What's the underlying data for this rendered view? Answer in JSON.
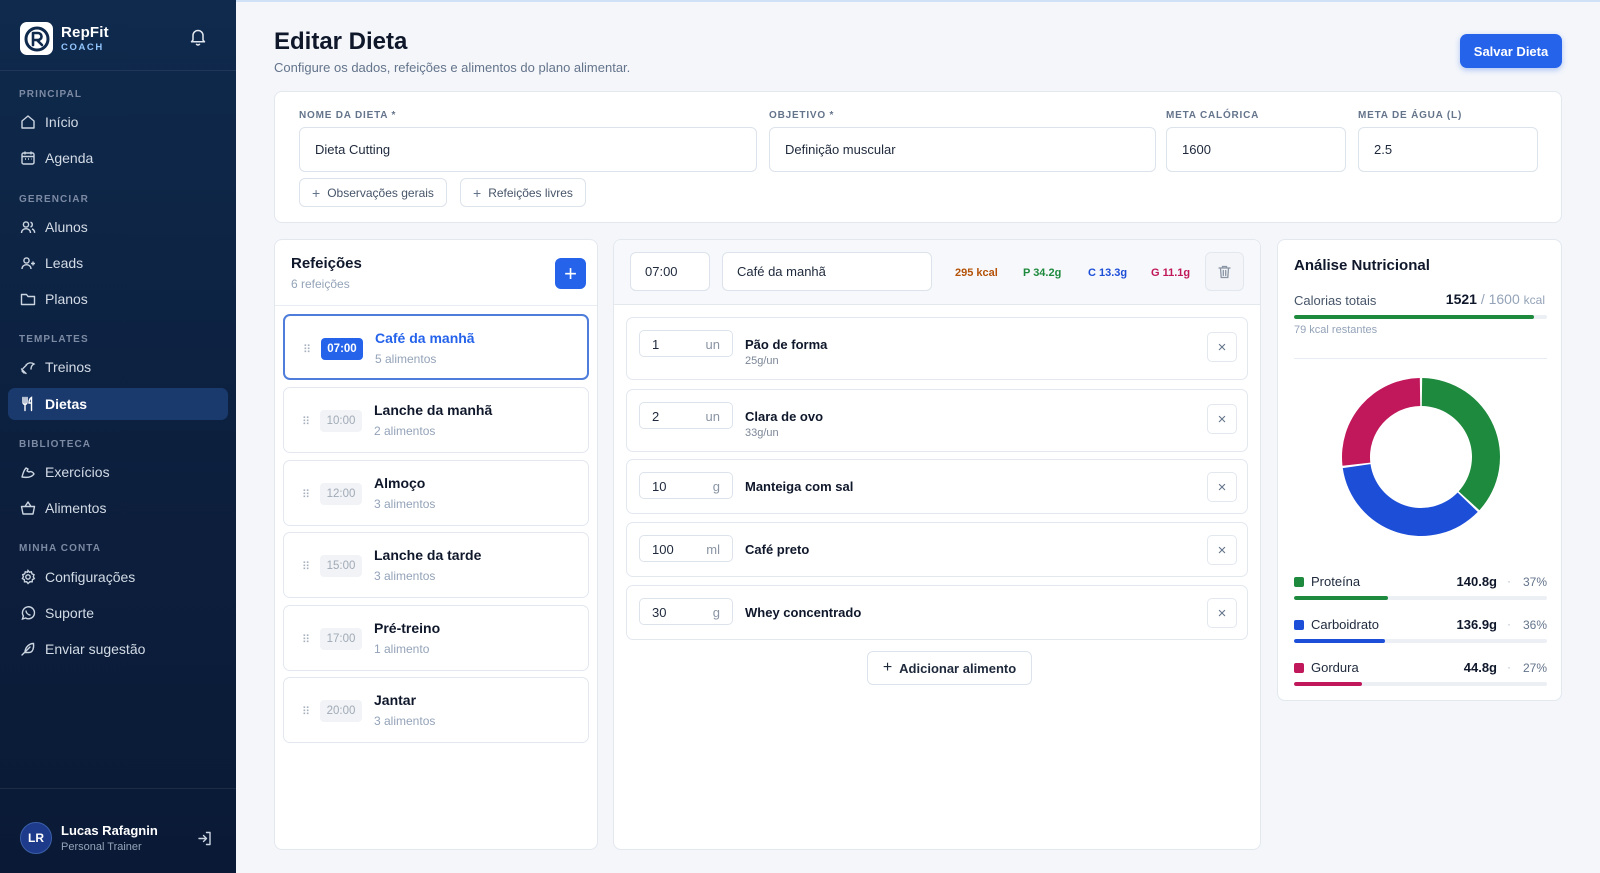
{
  "brand": {
    "name": "RepFit",
    "sub": "COACH"
  },
  "sidebar": {
    "sections": [
      "PRINCIPAL",
      "GERENCIAR",
      "TEMPLATES",
      "BIBLIOTECA",
      "MINHA CONTA"
    ],
    "items": [
      {
        "label": "Início",
        "icon": "home-icon"
      },
      {
        "label": "Agenda",
        "icon": "calendar-icon"
      },
      {
        "label": "Alunos",
        "icon": "users-icon"
      },
      {
        "label": "Leads",
        "icon": "user-plus-icon"
      },
      {
        "label": "Planos",
        "icon": "folder-icon"
      },
      {
        "label": "Treinos",
        "icon": "dumbbell-icon"
      },
      {
        "label": "Dietas",
        "icon": "utensils-icon"
      },
      {
        "label": "Exercícios",
        "icon": "biceps-icon"
      },
      {
        "label": "Alimentos",
        "icon": "basket-icon"
      },
      {
        "label": "Configurações",
        "icon": "gear-icon"
      },
      {
        "label": "Suporte",
        "icon": "whatsapp-icon"
      },
      {
        "label": "Enviar sugestão",
        "icon": "feather-icon"
      }
    ],
    "active_item": "Dietas"
  },
  "user": {
    "initials": "LR",
    "name": "Lucas Rafagnin",
    "role": "Personal Trainer"
  },
  "header": {
    "title": "Editar Dieta",
    "subtitle": "Configure os dados, refeições e alimentos do plano alimentar.",
    "save_label": "Salvar Dieta"
  },
  "form": {
    "name_label": "NOME DA DIETA *",
    "name_value": "Dieta Cutting",
    "goal_label": "OBJETIVO *",
    "goal_value": "Definição muscular",
    "calorie_label": "META CALÓRICA",
    "calorie_value": "1600",
    "water_label": "META DE ÁGUA (L)",
    "water_value": "2.5",
    "notes_button": "Observações gerais",
    "free_meals_button": "Refeições livres"
  },
  "meals": {
    "title": "Refeições",
    "count": "6 refeições",
    "items": [
      {
        "time": "07:00",
        "name": "Café da manhã",
        "count": "5 alimentos"
      },
      {
        "time": "10:00",
        "name": "Lanche da manhã",
        "count": "2 alimentos"
      },
      {
        "time": "12:00",
        "name": "Almoço",
        "count": "3 alimentos"
      },
      {
        "time": "15:00",
        "name": "Lanche da tarde",
        "count": "3 alimentos"
      },
      {
        "time": "17:00",
        "name": "Pré-treino",
        "count": "1 alimento"
      },
      {
        "time": "20:00",
        "name": "Jantar",
        "count": "3 alimentos"
      }
    ]
  },
  "editor": {
    "time": "07:00",
    "meal_name": "Café da manhã",
    "kcal": "295 kcal",
    "protein": "P 34.2g",
    "carbs": "C 13.3g",
    "fat": "G 11.1g",
    "foods": [
      {
        "qty": "1",
        "unit": "un",
        "name": "Pão de forma",
        "detail": "25g/un"
      },
      {
        "qty": "2",
        "unit": "un",
        "name": "Clara de ovo",
        "detail": "33g/un"
      },
      {
        "qty": "10",
        "unit": "g",
        "name": "Manteiga com sal",
        "detail": ""
      },
      {
        "qty": "100",
        "unit": "ml",
        "name": "Café preto",
        "detail": ""
      },
      {
        "qty": "30",
        "unit": "g",
        "name": "Whey concentrado",
        "detail": ""
      }
    ],
    "add_food_label": "Adicionar alimento"
  },
  "analysis": {
    "title": "Análise Nutricional",
    "calories_label": "Calorias totais",
    "calories_total": "1521",
    "calories_goal": "/ 1600",
    "calories_unit": "kcal",
    "calories_progress": 0.95,
    "remaining": "79 kcal restantes",
    "macros": [
      {
        "name": "Proteína",
        "grams": "140.8g",
        "pct": "37%",
        "fraction": 0.37,
        "color": "#1e8a3e"
      },
      {
        "name": "Carboidrato",
        "grams": "136.9g",
        "pct": "36%",
        "fraction": 0.36,
        "color": "#1d4ed8"
      },
      {
        "name": "Gordura",
        "grams": "44.8g",
        "pct": "27%",
        "fraction": 0.27,
        "color": "#c0185a"
      }
    ]
  },
  "colors": {
    "accent": "#2563eb",
    "sidebar": "#0f2a4d",
    "kcal": "#b45309",
    "protein": "#1e8a3e",
    "carbs": "#1d4ed8",
    "fat": "#c0185a"
  }
}
